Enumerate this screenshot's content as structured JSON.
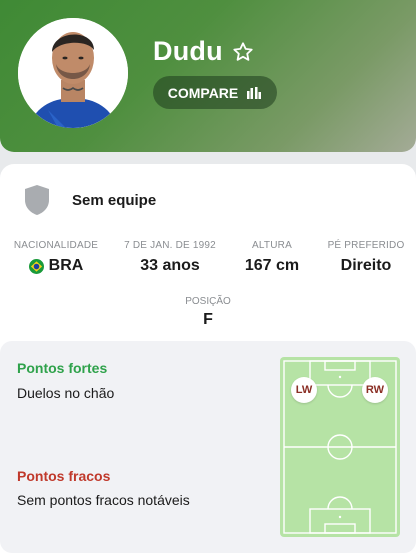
{
  "player": {
    "name": "Dudu",
    "compare_label": "COMPARE"
  },
  "team": {
    "name": "Sem equipe"
  },
  "stats": [
    {
      "label": "NACIONALIDADE",
      "value": "BRA"
    },
    {
      "label": "7 DE JAN. DE 1992",
      "value": "33 anos"
    },
    {
      "label": "ALTURA",
      "value": "167 cm"
    },
    {
      "label": "PÉ PREFERIDO",
      "value": "Direito"
    }
  ],
  "position": {
    "label": "POSIÇÃO",
    "value": "F"
  },
  "strengths": {
    "title": "Pontos fortes",
    "item": "Duelos no chão"
  },
  "weaknesses": {
    "title": "Pontos fracos",
    "item": "Sem pontos fracos notáveis"
  },
  "pitch_positions": [
    "LW",
    "RW"
  ],
  "colors": {
    "header_green": "#4f8f3f",
    "strength_green": "#2fa24b",
    "weakness_red": "#c0392b",
    "pitch_green": "#b6e3a5"
  },
  "icons": {
    "favorite": "star-outline-icon",
    "compare": "compare-bars-icon",
    "team": "shield-icon",
    "flag": "brazil-flag-icon"
  }
}
